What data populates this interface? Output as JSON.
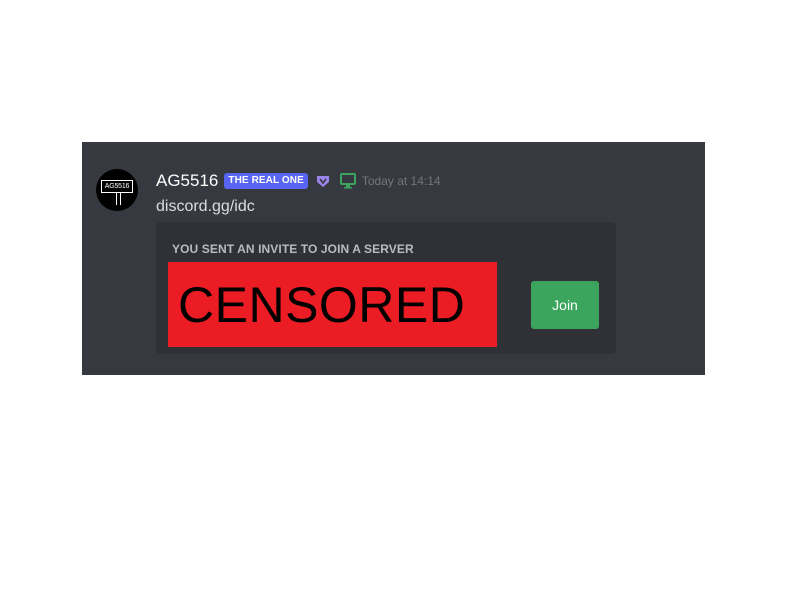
{
  "message": {
    "author": {
      "avatar_label": "AG5516",
      "username": "AG5516",
      "role_badge": "THE REAL ONE",
      "badge_icon": "hypesquad-badge-icon",
      "status_icon": "desktop-online-icon"
    },
    "timestamp": "Today at 14:14",
    "content": "discord.gg/idc"
  },
  "invite": {
    "heading": "YOU SENT AN INVITE TO JOIN A SERVER",
    "censor_label": "CENSORED",
    "join_label": "Join"
  },
  "colors": {
    "background": "#36393f",
    "card": "#2f3136",
    "role_badge": "#5865f2",
    "badge_icon": "#9b84ec",
    "status_icon": "#3ba55d",
    "censor": "#ec1c24",
    "join_button": "#3ba55d"
  }
}
